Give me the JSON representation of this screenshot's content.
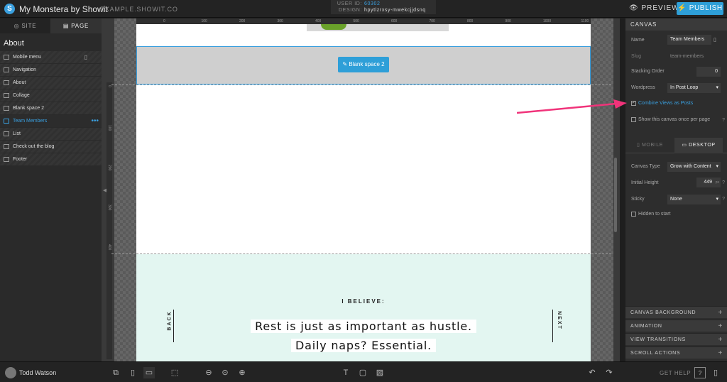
{
  "topbar": {
    "logo_letter": "S",
    "site_title": "My Monstera by Showit",
    "site_url": "EXAMPLE.SHOWIT.CO",
    "user_id_label": "USER ID:",
    "user_id_value": "60302",
    "design_label": "DESIGN:",
    "design_value": "hpytlzrxsy-mwekcjjdsnq",
    "preview_label": "PREVIEW",
    "publish_label": "PUBLISH",
    "accent_color": "#2e9fd8"
  },
  "left_panel": {
    "tabs": [
      {
        "label": "SITE",
        "icon": "globe-icon"
      },
      {
        "label": "PAGE",
        "icon": "page-icon"
      }
    ],
    "page_title": "About",
    "canvases": [
      {
        "label": "Mobile menu",
        "extra": "▯",
        "active": false
      },
      {
        "label": "Navigation",
        "extra": "",
        "active": false
      },
      {
        "label": "About",
        "extra": "",
        "active": false
      },
      {
        "label": "Collage",
        "extra": "",
        "active": false
      },
      {
        "label": "Blank space 2",
        "extra": "",
        "active": false
      },
      {
        "label": "Team Members",
        "extra": "•••",
        "active": true
      },
      {
        "label": "List",
        "extra": "",
        "active": false
      },
      {
        "label": "Check out the blog",
        "extra": "",
        "active": false
      },
      {
        "label": "Footer",
        "extra": "",
        "active": false
      }
    ]
  },
  "canvas_area": {
    "ruler_ticks": [
      "0",
      "100",
      "200",
      "300",
      "400",
      "500",
      "600",
      "700",
      "800",
      "900",
      "1000",
      "1100"
    ],
    "side_ruler_ticks": [
      "0",
      "100",
      "200",
      "300",
      "400"
    ],
    "blank_space_button": "Blank space 2",
    "believe": "I BELIEVE:",
    "quote_line1": "Rest is just as important as hustle.",
    "quote_line2": "Daily naps? Essential.",
    "back_label": "BACK",
    "next_label": "NEXT"
  },
  "right_panel": {
    "header": "CANVAS",
    "name_label": "Name",
    "name_value": "Team Members",
    "slug_label": "Slug",
    "slug_value": "team-members",
    "stacking_label": "Stacking Order",
    "stacking_value": "0",
    "wordpress_label": "Wordpress",
    "wordpress_value": "In Post Loop",
    "combine_label": "Combine Views as Posts",
    "combine_checked": true,
    "show_once_label": "Show this canvas once per page",
    "mobile_tab": "MOBILE",
    "desktop_tab": "DESKTOP",
    "canvas_type_label": "Canvas Type",
    "canvas_type_value": "Grow with Content",
    "initial_height_label": "Initial Height",
    "initial_height_value": "449",
    "initial_height_unit": "px",
    "sticky_label": "Sticky",
    "sticky_value": "None",
    "hidden_label": "Hidden to start",
    "sections": [
      "CANVAS BACKGROUND",
      "ANIMATION",
      "VIEW TRANSITIONS",
      "SCROLL ACTIONS"
    ]
  },
  "bottombar": {
    "username": "Todd Watson",
    "get_help": "GET HELP"
  },
  "annotation_arrow_color": "#f0337a"
}
